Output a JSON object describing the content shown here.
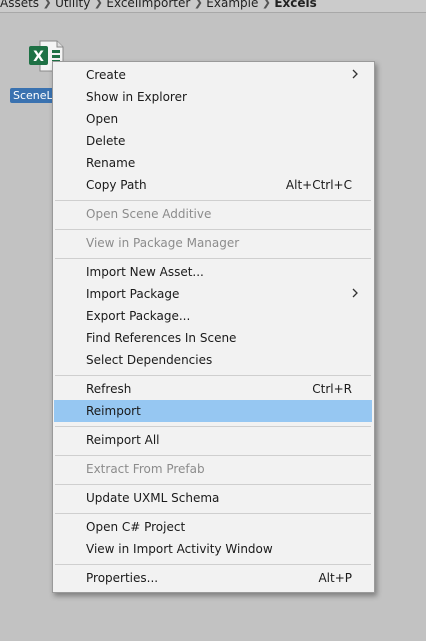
{
  "breadcrumb": [
    "Assets",
    "Utility",
    "ExcelImporter",
    "Example",
    "Excels"
  ],
  "asset": {
    "label": "SceneL",
    "icon": "excel-file-icon"
  },
  "menu": {
    "create": "Create",
    "show_in_explorer": "Show in Explorer",
    "open": "Open",
    "delete": "Delete",
    "rename": "Rename",
    "copy_path": "Copy Path",
    "copy_path_shortcut": "Alt+Ctrl+C",
    "open_scene_additive": "Open Scene Additive",
    "view_in_package_manager": "View in Package Manager",
    "import_new_asset": "Import New Asset...",
    "import_package": "Import Package",
    "export_package": "Export Package...",
    "find_references": "Find References In Scene",
    "select_dependencies": "Select Dependencies",
    "refresh": "Refresh",
    "refresh_shortcut": "Ctrl+R",
    "reimport": "Reimport",
    "reimport_all": "Reimport All",
    "extract_from_prefab": "Extract From Prefab",
    "update_uxml_schema": "Update UXML Schema",
    "open_csharp_project": "Open C# Project",
    "view_import_activity": "View in Import Activity Window",
    "properties": "Properties...",
    "properties_shortcut": "Alt+P"
  },
  "colors": {
    "highlight": "#96c7f2",
    "selection": "#3a72b0"
  }
}
